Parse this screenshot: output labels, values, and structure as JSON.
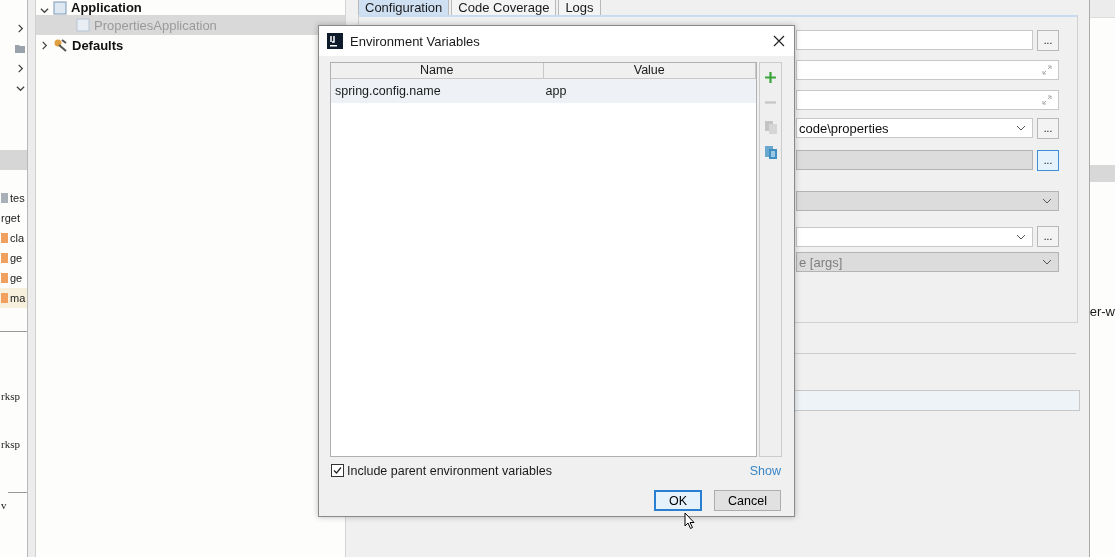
{
  "project_strip": {
    "arrows": [
      {
        "kind": "arrow",
        "expanded": false
      },
      {
        "kind": "folder"
      },
      {
        "kind": "arrow",
        "expanded": false
      },
      {
        "kind": "arrow",
        "expanded": true
      }
    ],
    "files": [
      {
        "name": "tes",
        "color": "#a9b0b8"
      },
      {
        "name": "rget"
      },
      {
        "name": "cla",
        "color": "#f2a05e"
      },
      {
        "name": "ge",
        "color": "#f2a05e"
      },
      {
        "name": "ge",
        "color": "#f2a05e"
      },
      {
        "name": "ma",
        "color": "#f2a05e"
      }
    ],
    "console_lines": [
      "rksp",
      "rksp",
      "v"
    ]
  },
  "tree": [
    {
      "label": "Application",
      "expanded": true,
      "selected": false,
      "children": [
        {
          "label": "PropertiesApplication",
          "selected": true
        }
      ]
    },
    {
      "label": "Defaults",
      "expanded": false,
      "selected": false
    }
  ],
  "tabs": [
    {
      "label": "Configuration",
      "selected": true
    },
    {
      "label": "Code Coverage",
      "selected": false
    },
    {
      "label": "Logs",
      "selected": false
    }
  ],
  "config_form": {
    "rows": [
      {
        "kind": "browse",
        "disabled": false,
        "button": "...",
        "focused": false
      },
      {
        "kind": "expand"
      },
      {
        "kind": "expand"
      },
      {
        "kind": "combo",
        "value": "code\\properties",
        "button": "...",
        "focused": false
      },
      {
        "kind": "browse",
        "disabled": true,
        "button": "...",
        "focused": true
      },
      {
        "kind": "select",
        "disabled": true
      },
      {
        "kind": "combo",
        "button": "...",
        "focused": false
      },
      {
        "kind": "select",
        "disabled": true,
        "value": "e [args]"
      }
    ]
  },
  "right_strip": {
    "text": "er-w"
  },
  "dialog": {
    "title": "Environment Variables",
    "columns": [
      "Name",
      "Value"
    ],
    "rows": [
      {
        "name": "spring.config.name",
        "value": "app",
        "selected": true
      }
    ],
    "toolbar": [
      {
        "kind": "add",
        "disabled": false
      },
      {
        "kind": "remove",
        "disabled": true
      },
      {
        "kind": "copy",
        "disabled": true
      },
      {
        "kind": "paste",
        "disabled": false
      }
    ],
    "include_parent": {
      "label": "Include parent environment variables",
      "checked": true
    },
    "show_link": "Show",
    "buttons": [
      {
        "label": "OK",
        "default": true
      },
      {
        "label": "Cancel",
        "default": false
      }
    ]
  }
}
